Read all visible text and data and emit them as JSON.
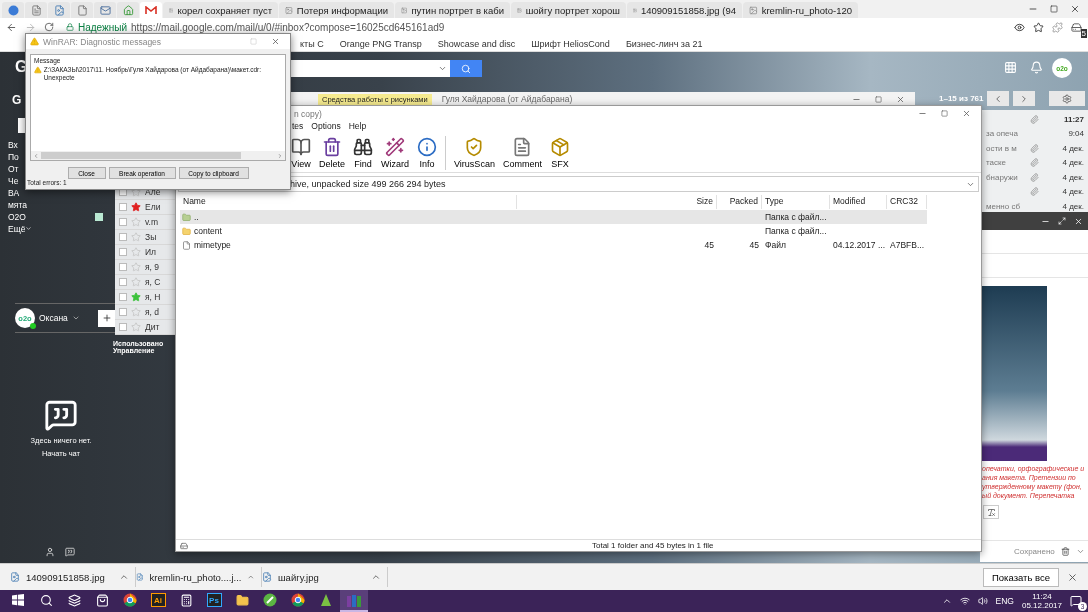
{
  "browser": {
    "pinned_tabs": [
      {
        "selected": false
      },
      {
        "selected": false
      },
      {
        "selected": false
      },
      {
        "selected": false
      },
      {
        "selected": false
      },
      {
        "selected": false
      },
      {
        "selected": true
      }
    ],
    "tabs": [
      {
        "title": "корел сохраняет пуст",
        "selected": false
      },
      {
        "title": "Потеря информации",
        "selected": false
      },
      {
        "title": "путин портрет в каби",
        "selected": false
      },
      {
        "title": "шойгу портрет хорош",
        "selected": false
      },
      {
        "title": "140909151858.jpg (94",
        "selected": false
      },
      {
        "title": "kremlin-ru_photo-120",
        "selected": false
      }
    ],
    "security_label": "Надежный",
    "url": "https://mail.google.com/mail/u/0/#inbox?compose=16025cd645161ad9",
    "extension_badge": "5",
    "bookmarks": [
      "кты С",
      "Orange PNG Transp",
      "Showcase and disc",
      "Шрифт HeliosCond",
      "Бизнес-линч за 21"
    ]
  },
  "gmail": {
    "logo_letters": [
      "G",
      "G"
    ],
    "page_info": "1–15 из 761",
    "labels": [
      {
        "label": "Вх",
        "menu": false
      },
      {
        "label": "По",
        "menu": false
      },
      {
        "label": "От",
        "menu": false
      },
      {
        "label": "Че",
        "menu": false
      },
      {
        "label": "ВА",
        "menu": false
      },
      {
        "label": "мята",
        "menu": false
      },
      {
        "label": "O2O",
        "color": "#b9e8d2",
        "menu": false
      },
      {
        "label": "Ещё",
        "menu": true
      }
    ],
    "mail_rows": [
      {
        "sender": "Але",
        "starred": false,
        "checked": false
      },
      {
        "sender": "Ели",
        "starred": true,
        "color": "#e02020",
        "checked": false
      },
      {
        "sender": "v.m",
        "starred": false,
        "checked": false
      },
      {
        "sender": "Зы",
        "starred": false,
        "checked": false
      },
      {
        "sender": "Ил",
        "starred": false,
        "checked": false
      },
      {
        "sender": "я, 9",
        "starred": false,
        "checked": false
      },
      {
        "sender": "я, С",
        "starred": false,
        "checked": false
      },
      {
        "sender": "я, Н",
        "starred": true,
        "color": "#3cc23c",
        "checked": false
      },
      {
        "sender": "я, d",
        "starred": false,
        "checked": false
      },
      {
        "sender": "Дит",
        "starred": false,
        "checked": false
      }
    ],
    "header_avatar": "o2o",
    "account": {
      "avatar": "o2o",
      "name": "Оксана"
    },
    "storage": [
      "Использовано",
      "Управление"
    ],
    "hangouts": {
      "empty": "Здесь ничего нет.",
      "action": "Начать чат"
    },
    "right_rows": [
      {
        "attachment": true,
        "date": "11:27",
        "unread": true
      },
      {
        "snippet": "за опеча",
        "attachment": false,
        "date": "9:04",
        "unread": false
      },
      {
        "snippet": "ости в м",
        "attachment": true,
        "date": "4 дек.",
        "unread": false
      },
      {
        "snippet": "таске",
        "attachment": true,
        "date": "4 дек.",
        "unread": false
      },
      {
        "snippet": "бнаружи",
        "attachment": true,
        "date": "4 дек.",
        "unread": false
      },
      {
        "attachment": true,
        "date": "4 дек.",
        "unread": false
      },
      {
        "snippet": "менно сб",
        "attachment": false,
        "date": "4 дек.",
        "unread": false
      }
    ],
    "compose": {
      "notice_lines": [
        "опечатки, орфографические и",
        "ания макета. Претензии по",
        "утвержденному макету (фон,",
        "ый документ. Перепечатка"
      ],
      "saved": "Сохранено"
    }
  },
  "word": {
    "context_tab": "Средства работы с рисунками",
    "title": "Гуля Хайдарова (от Айдабарана)"
  },
  "winrar": {
    "title": "n copy)",
    "menu": [
      "tes",
      "Options",
      "Help"
    ],
    "tools": [
      "View",
      "Delete",
      "Find",
      "Wizard",
      "Info",
      "VirusScan",
      "Comment",
      "SFX"
    ],
    "path": "hive, unpacked size 499 266 294 bytes",
    "columns": [
      "Name",
      "Size",
      "Packed",
      "Type",
      "Modified",
      "CRC32"
    ],
    "rows": [
      {
        "kind": "up",
        "name": "..",
        "type": "Папка с файл...",
        "selected": true
      },
      {
        "kind": "folder",
        "name": "content",
        "type": "Папка с файл...",
        "selected": false
      },
      {
        "kind": "file",
        "name": "mimetype",
        "size": "45",
        "packed": "45",
        "type": "Файл",
        "modified": "04.12.2017 ...",
        "crc": "A7BFB...",
        "selected": false
      }
    ],
    "status": "Total 1 folder and 45 bytes in 1 file"
  },
  "dialog": {
    "title": "WinRAR: Diagnostic messages",
    "column": "Message",
    "messages": [
      "Z:\\ЗАКАЗЫ\\2017\\11. Ноябрь\\Гуля Хайдарова (от Айдабарана)\\макет.cdr: Unexpecte"
    ],
    "buttons": [
      "Close",
      "Break operation",
      "Copy to clipboard"
    ],
    "summary": "Total errors: 1"
  },
  "downloads": {
    "items": [
      "140909151858.jpg",
      "kremlin-ru_photo....j...",
      "шайгу.jpg"
    ],
    "show_all": "Показать все"
  },
  "taskbar": {
    "apps": [
      {
        "selected": false
      },
      {
        "selected": false
      },
      {
        "selected": false
      },
      {
        "selected": false
      },
      {
        "selected": false
      },
      {
        "label": "Ai",
        "selected": false
      },
      {
        "selected": false
      },
      {
        "label": "Ps",
        "selected": false
      },
      {
        "selected": false
      },
      {
        "selected": false
      },
      {
        "selected": false
      },
      {
        "selected": false
      },
      {
        "selected": true
      }
    ],
    "language": "ENG",
    "time": "11:24",
    "date": "05.12.2017",
    "notifications": "3"
  }
}
